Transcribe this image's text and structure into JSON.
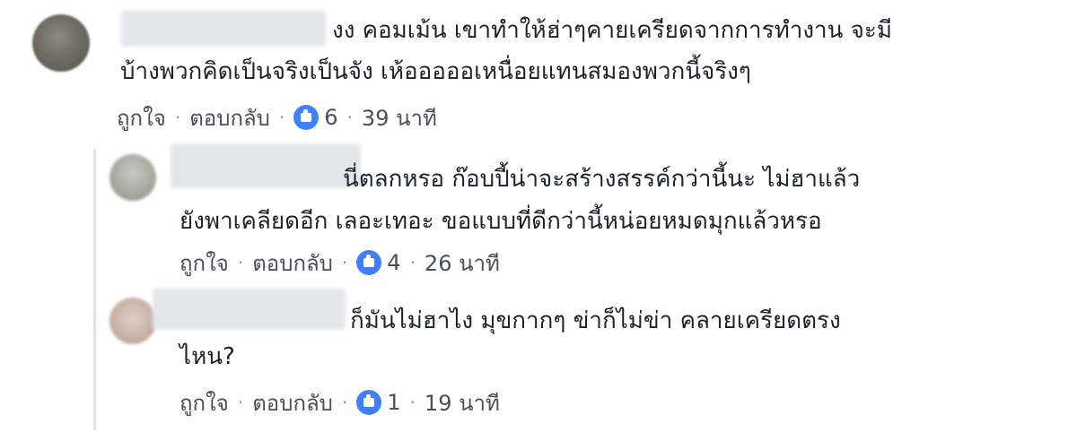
{
  "comments": [
    {
      "line1": "งง คอมเม้น เขาทำให้ฮ่าๆคายเครียดจากการทำงาน จะมี",
      "line2": "บ้างพวกคิดเป็นจริงเป็นจัง เห้อออออเหนื่อยแทนสมองพวกนี้จริงๆ",
      "like_label": "ถูกใจ",
      "reply_label": "ตอบกลับ",
      "separator": "·",
      "like_count": "6",
      "time": "39 นาที"
    },
    {
      "line1": "นี่ตลกหรอ ก๊อบปี้น่าจะสร้างสรรค์กว่านี้นะ ไม่ฮาแล้ว",
      "line2": "ยังพาเคลียดอีก เลอะเทอะ ขอแบบที่ดีกว่านี้หน่อยหมดมุกแล้วหรอ",
      "like_label": "ถูกใจ",
      "reply_label": "ตอบกลับ",
      "separator": "·",
      "like_count": "4",
      "time": "26 นาที"
    },
    {
      "line1": "ก็มันไม่ฮาไง มุขกากๆ ข่าก็ไม่ข่า คลายเครียดตรง",
      "line2": "ไหน?",
      "like_label": "ถูกใจ",
      "reply_label": "ตอบกลับ",
      "separator": "·",
      "like_count": "1",
      "time": "19 นาที"
    }
  ],
  "icons": {
    "like": "like-thumb-icon"
  },
  "colors": {
    "like_blue": "#4080ff",
    "text": "#1d2129",
    "meta": "#4b4f56"
  }
}
